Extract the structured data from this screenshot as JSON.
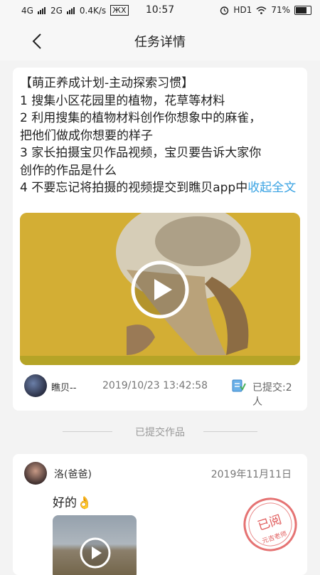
{
  "status_bar": {
    "network1": "4G",
    "network2": "2G",
    "speed": "0.4K/s",
    "extra": "Х",
    "time": "10:57",
    "hd": "HD1",
    "battery": "71%"
  },
  "nav": {
    "title": "任务详情"
  },
  "task": {
    "lines": [
      "【萌正养成计划-主动探索习惯】",
      "1  搜集小区花园里的植物，花草等材料",
      "2 利用搜集的植物材料创作你想象中的麻雀，",
      "把他们做成你想要的样子",
      "3 家长拍摄宝贝作品视频，宝贝要告诉大家你",
      "创作的作品是什么",
      "4 不要忘记将拍摄的视频提交到瞧贝app中"
    ],
    "collapse_label": "收起全文",
    "author": "瞧贝--",
    "time": "2019/10/23 13:42:58",
    "submitted": "已提交:2人"
  },
  "divider": {
    "label": "已提交作品"
  },
  "submission": {
    "user": "洛(爸爸)",
    "date": "2019年11月11日",
    "message": "好的",
    "message_emoji": "👌",
    "stamp_text": "已阅",
    "stamp_sub": "元吉老师"
  },
  "colors": {
    "accent": "#3aa3e3",
    "stamp": "#e05a5a"
  }
}
